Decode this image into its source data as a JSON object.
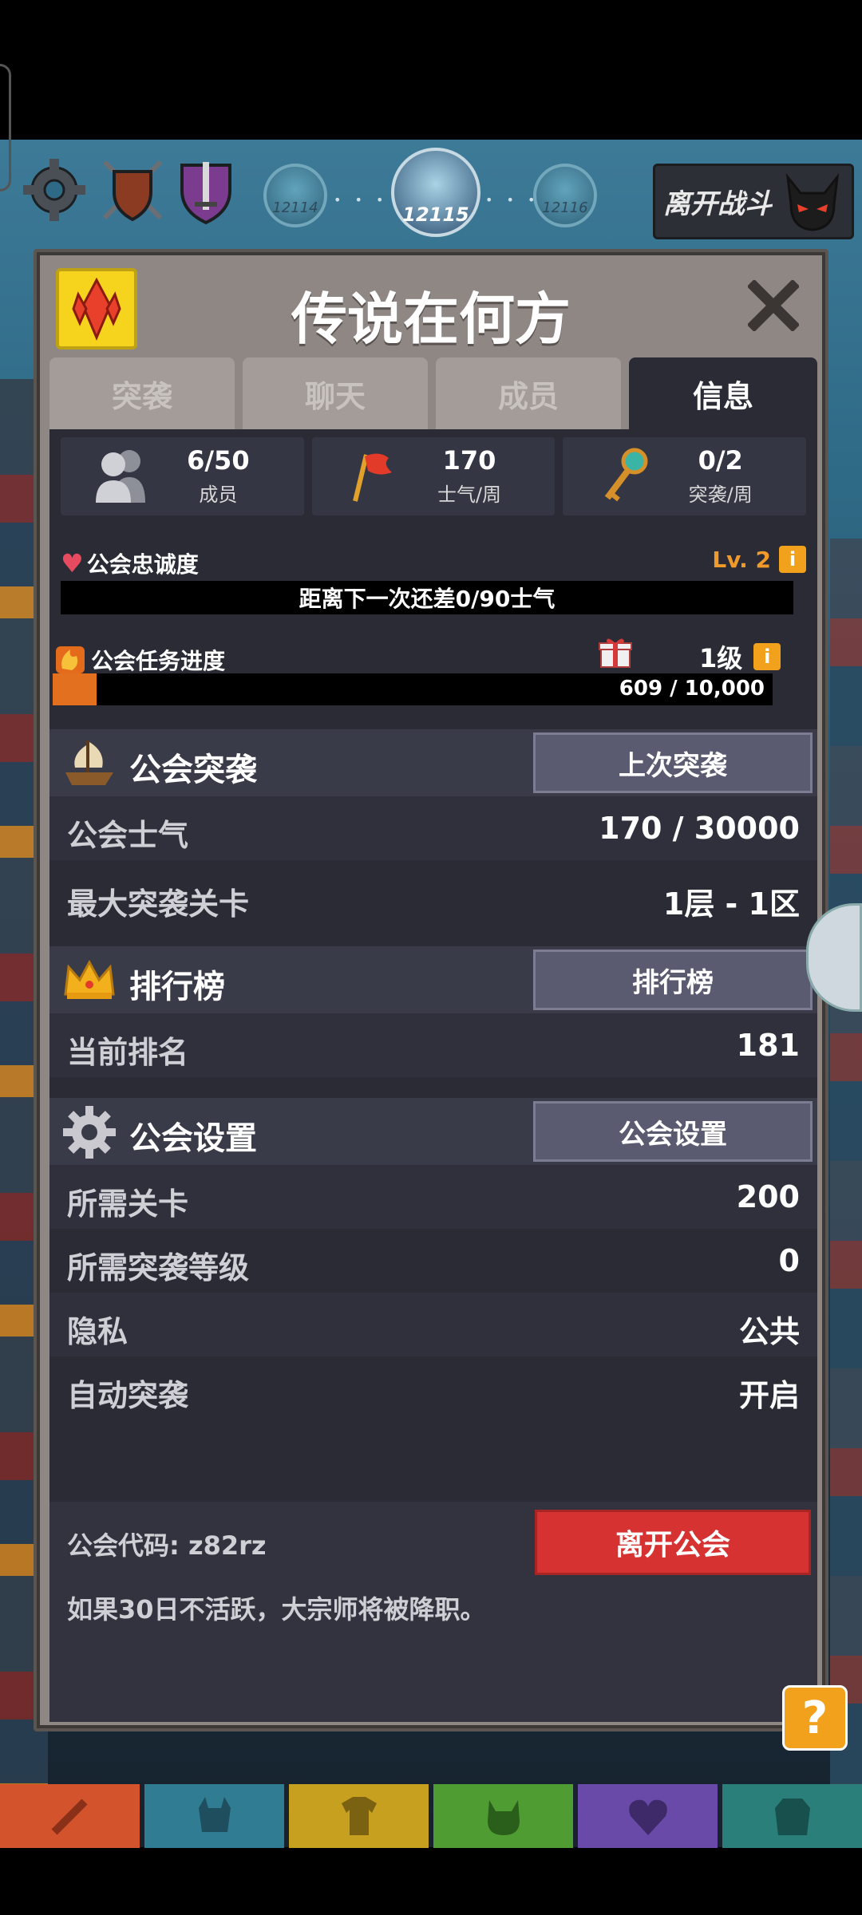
{
  "hud": {
    "levels": {
      "left": "12114",
      "current": "12115",
      "right": "12116"
    },
    "leave_battle": "离开战斗"
  },
  "modal": {
    "title": "传说在何方",
    "tabs": [
      "突袭",
      "聊天",
      "成员",
      "信息"
    ],
    "active_tab": "信息"
  },
  "stats": [
    {
      "value": "6/50",
      "label": "成员",
      "icon": "members-icon"
    },
    {
      "value": "170",
      "label": "士气/周",
      "icon": "flag-icon"
    },
    {
      "value": "0/2",
      "label": "突袭/周",
      "icon": "key-icon"
    }
  ],
  "loyalty": {
    "title": "公会忠诚度",
    "level": "Lv. 2",
    "bar_text": "距离下一次还差0/90士气",
    "info": "i"
  },
  "task": {
    "title": "公会任务进度",
    "level": "1级",
    "info": "i",
    "progress_text": "609 / 10,000",
    "progress_fraction": 0.0609
  },
  "raid": {
    "title": "公会突袭",
    "button": "上次突袭",
    "morale_label": "公会士气",
    "morale_value": "170 / 30000",
    "max_stage_label": "最大突袭关卡",
    "max_stage_value": "1层 - 1区"
  },
  "ranking": {
    "title": "排行榜",
    "button": "排行榜",
    "current_label": "当前排名",
    "current_value": "181"
  },
  "settings": {
    "title": "公会设置",
    "button": "公会设置",
    "rows": [
      {
        "label": "所需关卡",
        "value": "200"
      },
      {
        "label": "所需突袭等级",
        "value": "0"
      },
      {
        "label": "隐私",
        "value": "公共"
      },
      {
        "label": "自动突袭",
        "value": "开启"
      }
    ]
  },
  "footer": {
    "guild_code": "公会代码: z82rz",
    "leave_button": "离开公会",
    "note": "如果30日不活跃，大宗师将被降职。"
  },
  "help": "?",
  "colors": {
    "accent_orange": "#f2a11d",
    "danger_red": "#d63232",
    "panel_dark": "#2b2b36"
  }
}
